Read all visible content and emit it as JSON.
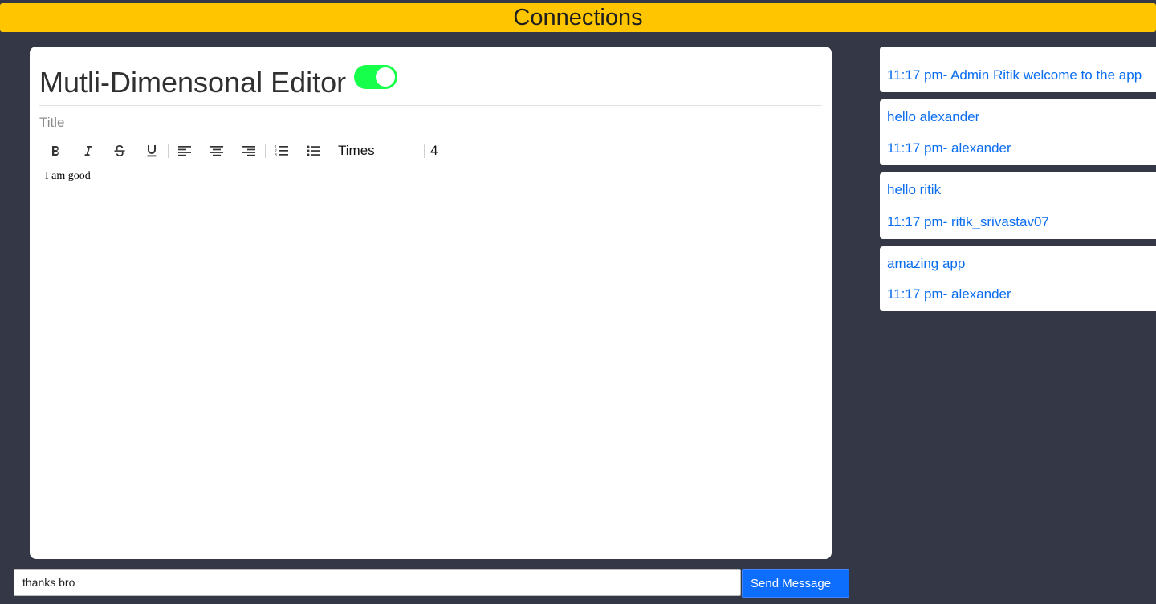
{
  "header": {
    "title": "Connections"
  },
  "editor": {
    "heading": "Mutli-Dimensonal Editor",
    "toggle_on": true,
    "toggle_color": "#16ff4a",
    "title_placeholder": "Title",
    "title_value": "",
    "toolbar": {
      "bold_icon": "bold-icon",
      "italic_icon": "italic-icon",
      "strike_icon": "strikethrough-icon",
      "underline_icon": "underline-icon",
      "align_left_icon": "align-left-icon",
      "align_center_icon": "align-center-icon",
      "align_right_icon": "align-right-icon",
      "ordered_list_icon": "ordered-list-icon",
      "bullet_list_icon": "bullet-list-icon",
      "font_family": "Times",
      "font_size": "4"
    },
    "body_text": "I am good"
  },
  "composer": {
    "input_value": "thanks bro",
    "send_label": "Send Message",
    "send_color": "#0d6efd"
  },
  "chat": {
    "messages": [
      {
        "text": "",
        "meta": "11:17 pm- Admin Ritik welcome to the app"
      },
      {
        "text": "hello alexander",
        "meta": "11:17 pm- alexander"
      },
      {
        "text": "hello ritik",
        "meta": "11:17 pm- ritik_srivastav07"
      },
      {
        "text": "amazing app",
        "meta": "11:17 pm- alexander"
      }
    ]
  },
  "colors": {
    "background": "#343746",
    "header_bar": "#ffc600",
    "chat_text": "#0a6df0"
  }
}
